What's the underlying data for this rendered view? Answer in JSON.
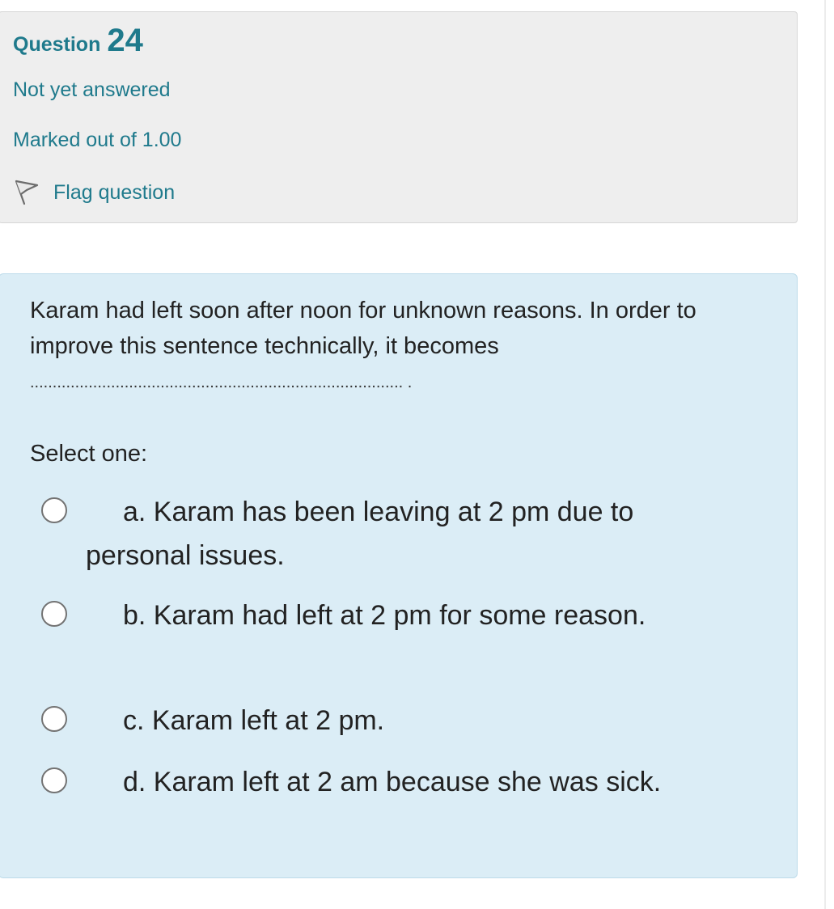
{
  "question_info": {
    "number_word": "Question",
    "number": "24",
    "state": "Not yet answered",
    "grade": "Marked out of 1.00",
    "flag_label": "Flag question"
  },
  "question": {
    "text": "Karam had left soon after noon for unknown reasons. In order to improve this sentence technically, it becomes",
    "blank": "................................................................................... .",
    "prompt": "Select one:",
    "options": [
      {
        "label": "a. Karam has been leaving at 2 pm due to personal issues.",
        "selected": false
      },
      {
        "label": "b. Karam had left at 2 pm for some reason.",
        "selected": false
      },
      {
        "label": "c. Karam left at 2 pm.",
        "selected": false
      },
      {
        "label": "d. Karam left at 2 am because she was sick.",
        "selected": false
      }
    ]
  },
  "colors": {
    "accent": "#1f7a8c",
    "info_bg": "#eeeeee",
    "content_bg": "#dbedf6",
    "radio_border": "#737373"
  },
  "icons": {
    "flag": "flag-icon",
    "radio": "radio-button"
  }
}
